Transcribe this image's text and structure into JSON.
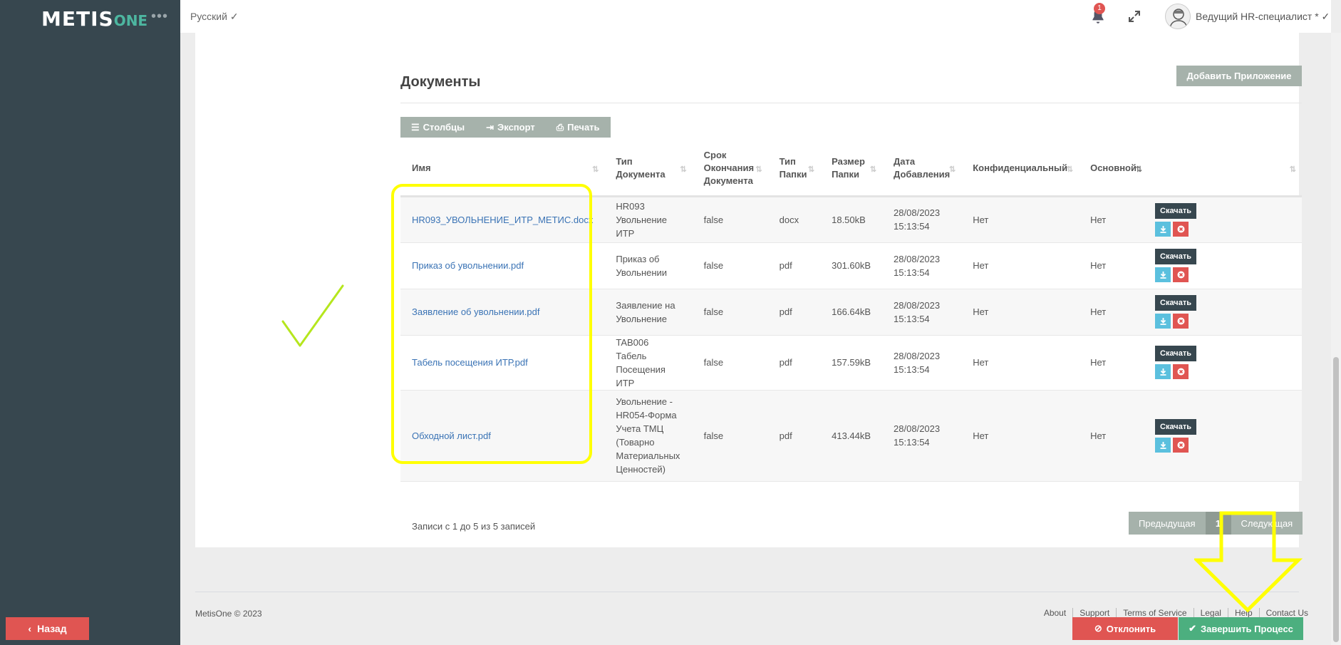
{
  "app": {
    "logo_main": "METIS",
    "logo_suffix": "ONE",
    "menu_glyph": "•••"
  },
  "topbar": {
    "language": "Русский",
    "notification_count": "1",
    "user_role": "Ведущий HR-специалист *"
  },
  "section": {
    "title": "Документы",
    "add_button": "Добавить Приложение"
  },
  "toolbar": {
    "columns": "Столбцы",
    "export": "Экспорт",
    "print": "Печать"
  },
  "table": {
    "headers": [
      "Имя",
      "Тип Документа",
      "Срок Окончания Документа",
      "Тип Папки",
      "Размер Папки",
      "Дата Добавления",
      "Конфиденциальный",
      "Основной",
      ""
    ],
    "download_label": "Скачать",
    "rows": [
      {
        "name": "HR093_УВОЛЬНЕНИЕ_ИТР_МЕТИС.docx",
        "doc_type": "HR093 Увольнение ИТР",
        "expiry": "false",
        "folder_type": "docx",
        "size": "18.50kB",
        "date": "28/08/2023 15:13:54",
        "confidential": "Нет",
        "main": "Нет"
      },
      {
        "name": "Приказ об увольнении.pdf",
        "doc_type": "Приказ об Увольнении",
        "expiry": "false",
        "folder_type": "pdf",
        "size": "301.60kB",
        "date": "28/08/2023 15:13:54",
        "confidential": "Нет",
        "main": "Нет"
      },
      {
        "name": "Заявление об увольнении.pdf",
        "doc_type": "Заявление на Увольнение",
        "expiry": "false",
        "folder_type": "pdf",
        "size": "166.64kB",
        "date": "28/08/2023 15:13:54",
        "confidential": "Нет",
        "main": "Нет"
      },
      {
        "name": "Табель посещения ИТР.pdf",
        "doc_type": "TAB006 Табель Посещения ИТР",
        "expiry": "false",
        "folder_type": "pdf",
        "size": "157.59kB",
        "date": "28/08/2023 15:13:54",
        "confidential": "Нет",
        "main": "Нет"
      },
      {
        "name": "Обходной лист.pdf",
        "doc_type": "Увольнение - HR054-Форма Учета ТМЦ (Товарно Материальных Ценностей)",
        "expiry": "false",
        "folder_type": "pdf",
        "size": "413.44kB",
        "date": "28/08/2023 15:13:54",
        "confidential": "Нет",
        "main": "Нет"
      }
    ]
  },
  "pagination": {
    "info": "Записи с 1 до 5 из 5 записей",
    "prev": "Предыдущая",
    "page": "1",
    "next": "Следующая"
  },
  "footer": {
    "copyright": "MetisOne © 2023",
    "links": [
      "About",
      "Support",
      "Terms of Service",
      "Legal",
      "Help",
      "Contact Us"
    ]
  },
  "actions": {
    "back": "Назад",
    "reject": "Отклонить",
    "finish": "Завершить Процесс"
  },
  "colors": {
    "sidebar": "#37474f",
    "accent_green": "#4caf7f",
    "danger": "#e05552",
    "link": "#3a73b5",
    "annotation_yellow": "#ffff00",
    "annotation_check": "#b5e61d"
  }
}
